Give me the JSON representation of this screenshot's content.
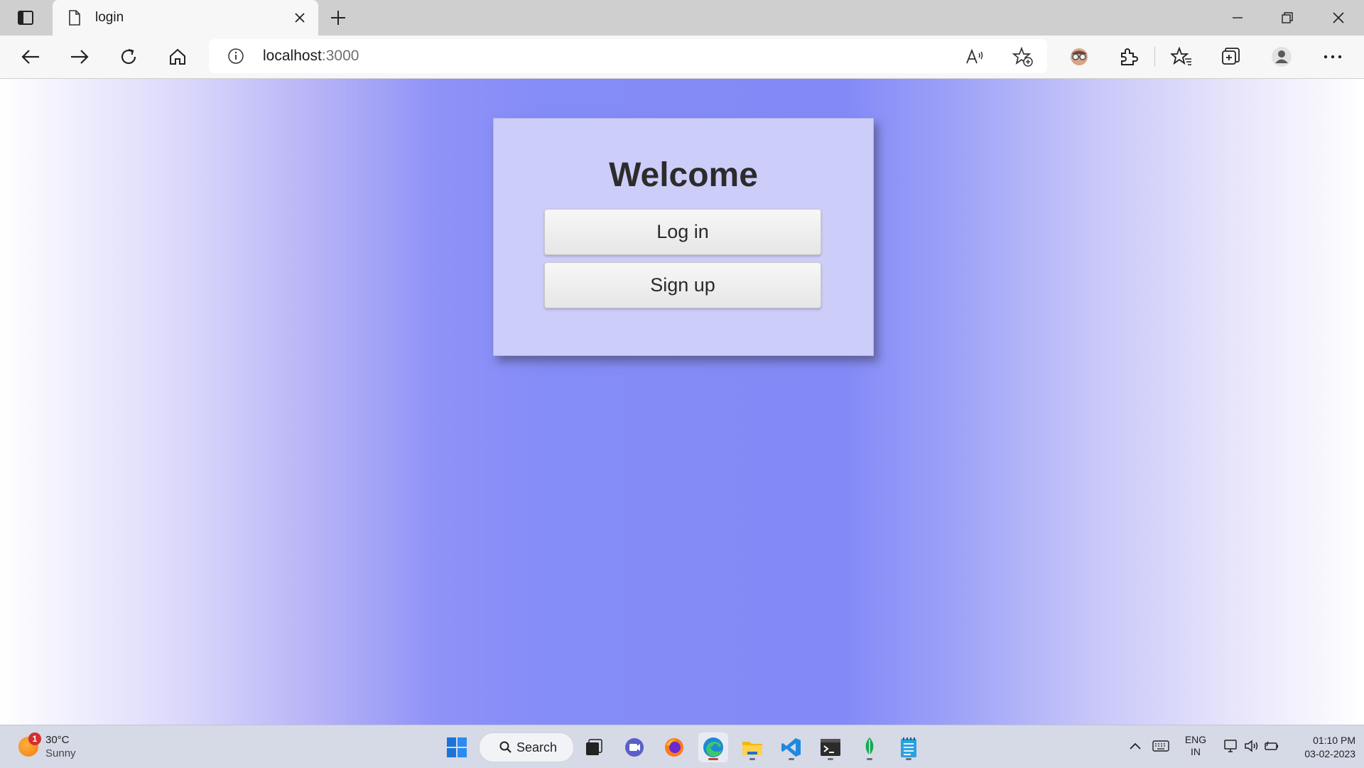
{
  "browser": {
    "tab": {
      "title": "login"
    },
    "address": {
      "host": "localhost",
      "port": ":3000"
    }
  },
  "page": {
    "heading": "Welcome",
    "login_label": "Log in",
    "signup_label": "Sign up",
    "colors": {
      "card_bg": "#cdcdfa",
      "gradient_center": "#838af7"
    }
  },
  "taskbar": {
    "weather": {
      "temp": "30°C",
      "condition": "Sunny",
      "badge": "1"
    },
    "search_label": "Search",
    "language": {
      "line1": "ENG",
      "line2": "IN"
    },
    "clock": {
      "time": "01:10 PM",
      "date": "03-02-2023"
    }
  }
}
